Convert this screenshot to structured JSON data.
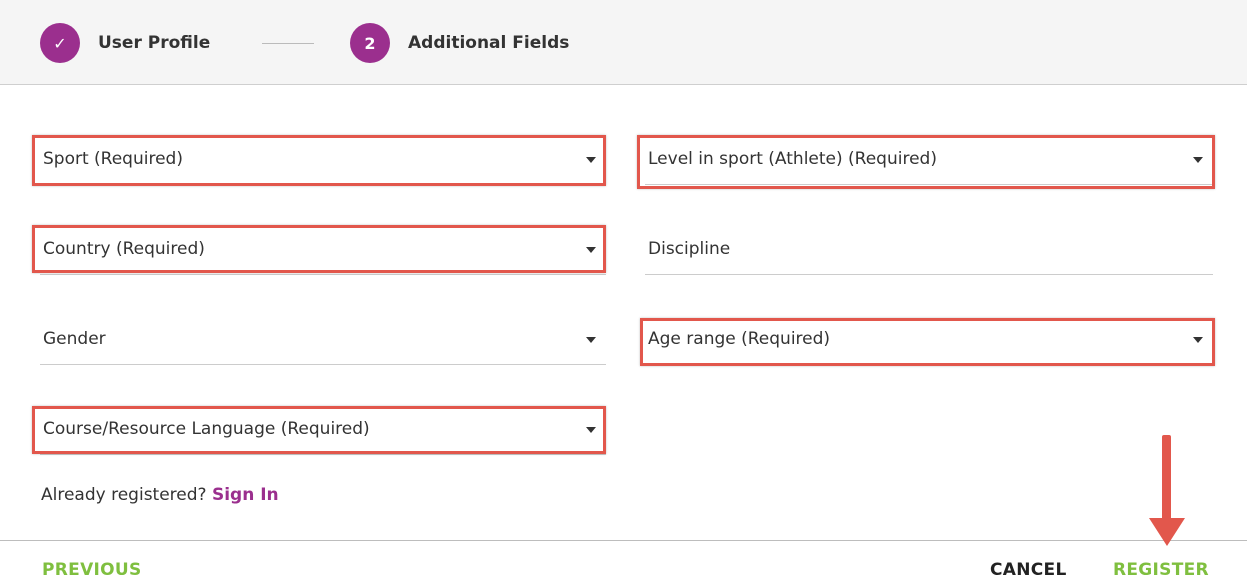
{
  "stepper": {
    "steps": [
      {
        "label": "User Profile",
        "marker": "✓",
        "icon": "check-icon",
        "status": "completed"
      },
      {
        "label": "Additional Fields",
        "marker": "2",
        "status": "current"
      }
    ],
    "accent_color": "#9b2f8e"
  },
  "form": {
    "fields": {
      "sport": {
        "label": "Sport (Required)",
        "type": "select"
      },
      "level": {
        "label": "Level in sport (Athlete) (Required)",
        "type": "select"
      },
      "country": {
        "label": "Country (Required)",
        "type": "select"
      },
      "discipline": {
        "label": "Discipline",
        "type": "text"
      },
      "gender": {
        "label": "Gender",
        "type": "select"
      },
      "age_range": {
        "label": "Age range (Required)",
        "type": "select"
      },
      "language": {
        "label": "Course/Resource Language (Required)",
        "type": "select"
      }
    },
    "highlight_color": "#e2574c"
  },
  "signin": {
    "prompt": "Already registered?",
    "link": "Sign In"
  },
  "footer": {
    "previous": "PREVIOUS",
    "cancel": "CANCEL",
    "register": "REGISTER",
    "action_color": "#7fbf3f"
  }
}
